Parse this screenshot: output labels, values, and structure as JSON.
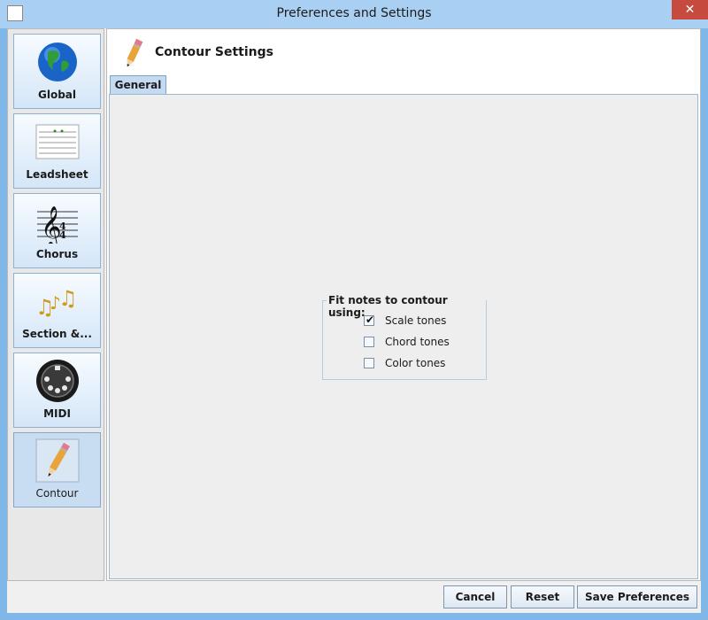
{
  "window": {
    "title": "Preferences and Settings",
    "close_glyph": "✕"
  },
  "sidebar": {
    "items": [
      {
        "label": "Global",
        "icon": "globe-icon",
        "selected": false
      },
      {
        "label": "Leadsheet",
        "icon": "leadsheet-icon",
        "selected": false
      },
      {
        "label": "Chorus",
        "icon": "treble-clef-icon",
        "selected": false
      },
      {
        "label": "Section &...",
        "icon": "music-notes-icon",
        "selected": false
      },
      {
        "label": "MIDI",
        "icon": "midi-connector-icon",
        "selected": false
      },
      {
        "label": "Contour",
        "icon": "pencil-icon",
        "selected": true
      }
    ]
  },
  "header": {
    "title": "Contour Settings",
    "icon": "pencil-icon"
  },
  "tabs": [
    {
      "label": "General",
      "selected": true
    }
  ],
  "fit_group": {
    "title": "Fit notes to contour using:",
    "options": [
      {
        "label": "Scale tones",
        "checked": true
      },
      {
        "label": "Chord tones",
        "checked": false
      },
      {
        "label": "Color tones",
        "checked": false
      }
    ],
    "check_glyph": "✔"
  },
  "buttons": {
    "cancel": "Cancel",
    "reset": "Reset",
    "save": "Save Preferences"
  },
  "colors": {
    "accent": "#a9d0f2",
    "selected_nav": "#c9ddf2",
    "close": "#c74a3f"
  }
}
